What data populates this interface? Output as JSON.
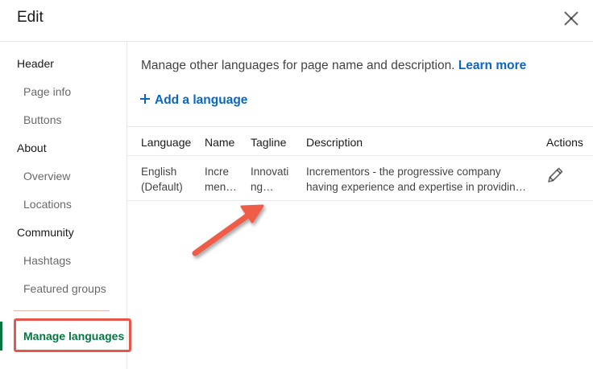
{
  "dialog": {
    "title": "Edit",
    "close_icon": "close-icon"
  },
  "sidebar": {
    "sections": [
      {
        "label": "Header",
        "items": [
          "Page info",
          "Buttons"
        ]
      },
      {
        "label": "About",
        "items": [
          "Overview",
          "Locations"
        ]
      },
      {
        "label": "Community",
        "items": [
          "Hashtags",
          "Featured groups"
        ]
      }
    ],
    "active_item": "Manage languages"
  },
  "main": {
    "intro_text": "Manage other languages for page name and description.",
    "learn_more": "Learn more",
    "add_language": "Add a language",
    "columns": [
      "Language",
      "Name",
      "Tagline",
      "Description",
      "Actions"
    ],
    "rows": [
      {
        "language": [
          "English",
          "(Default)"
        ],
        "name": [
          "Incre",
          "men…"
        ],
        "tagline": [
          "Innovati",
          "ng…"
        ],
        "description": [
          "Incrementors - the progressive company",
          "having experience and expertise in providin…"
        ],
        "action_icon": "pencil-icon"
      }
    ]
  },
  "colors": {
    "link": "#0a66c2",
    "active": "#057642",
    "highlight": "#e5574a"
  }
}
